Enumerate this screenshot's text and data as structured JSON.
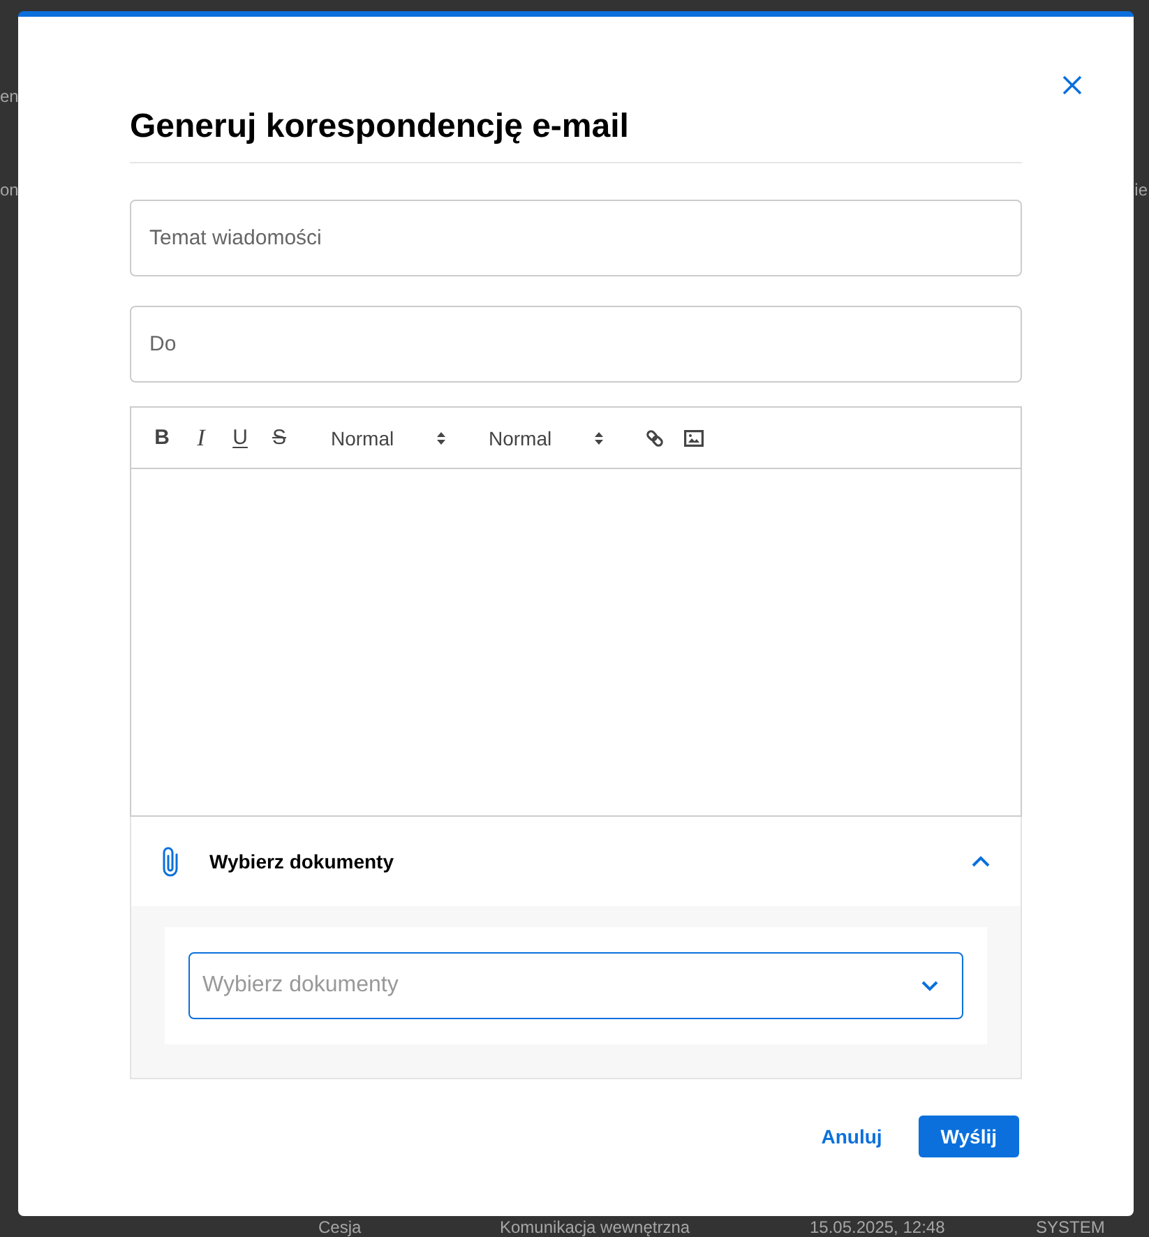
{
  "background": {
    "rows": [
      {
        "left": "en"
      },
      {
        "left": "on",
        "right": "ie"
      }
    ],
    "table_row": [
      "Cesja",
      "Komunikacja wewnętrzna",
      "15.05.2025, 12:48",
      "SYSTEM"
    ]
  },
  "dialog": {
    "title": "Generuj korespondencję e-mail",
    "fields": [
      {
        "placeholder": "Temat wiadomości"
      },
      {
        "placeholder": "Do"
      }
    ],
    "editor": {
      "toolbar": [
        {
          "kind": "bold",
          "label": "B"
        },
        {
          "kind": "italic",
          "label": "I"
        },
        {
          "kind": "underline",
          "label": "U"
        },
        {
          "kind": "strike",
          "label": "S"
        },
        {
          "kind": "picker",
          "label": "Normal"
        },
        {
          "kind": "picker",
          "label": "Normal"
        },
        {
          "kind": "link"
        },
        {
          "kind": "image"
        }
      ]
    },
    "attachments": {
      "title": "Wybierz dokumenty",
      "expanded": true,
      "select": {
        "placeholder": "Wybierz dokumenty"
      }
    },
    "buttons": [
      {
        "kind": "secondary",
        "label": "Anuluj"
      },
      {
        "kind": "primary",
        "label": "Wyślij"
      }
    ]
  }
}
